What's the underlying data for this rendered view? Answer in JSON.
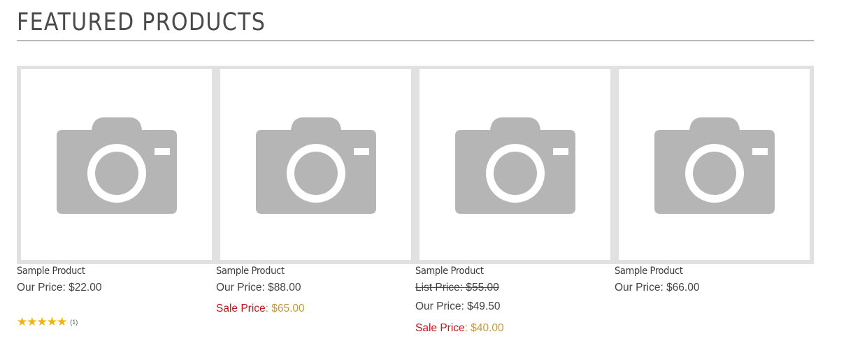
{
  "section": {
    "title": "FEATURED PRODUCTS"
  },
  "colors": {
    "frame": "#e1e1e1",
    "camera_icon": "#b5b5b5",
    "sale_label": "#c3161c",
    "sale_value": "#c49a3a",
    "stars": "#f2b305"
  },
  "products": [
    {
      "name": "Sample Product",
      "image_icon": "camera-placeholder-icon",
      "our_price": "Our Price: $22.00",
      "rating": {
        "stars": "★★★★★",
        "value": 5,
        "count": "(1)"
      }
    },
    {
      "name": "Sample Product",
      "image_icon": "camera-placeholder-icon",
      "our_price": "Our Price: $88.00",
      "sale_label": "Sale Price",
      "sale_value": ": $65.00"
    },
    {
      "name": "Sample Product",
      "image_icon": "camera-placeholder-icon",
      "list_price": "List Price: $55.00",
      "our_price": "Our Price: $49.50",
      "sale_label": "Sale Price",
      "sale_value": ": $40.00"
    },
    {
      "name": "Sample Product",
      "image_icon": "camera-placeholder-icon",
      "our_price": "Our Price: $66.00"
    }
  ]
}
